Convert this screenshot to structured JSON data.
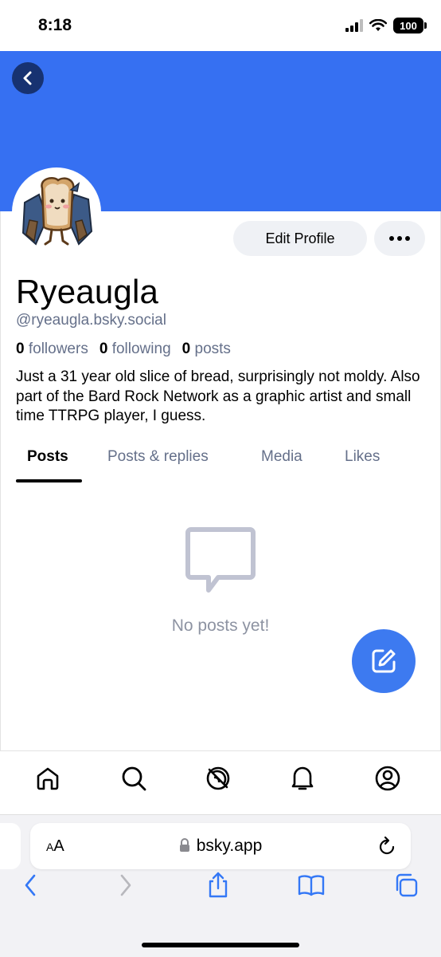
{
  "status_bar": {
    "time": "8:18",
    "battery": "100"
  },
  "profile": {
    "display_name": "Ryeaugla",
    "handle": "@ryeaugla.bsky.social",
    "followers_count": "0",
    "followers_label": "followers",
    "following_count": "0",
    "following_label": "following",
    "posts_count": "0",
    "posts_label": "posts",
    "bio": "Just a 31 year old slice of bread, surprisingly not moldy. Also part of the Bard Rock Network as a graphic artist and small time TTRPG player, I guess.",
    "edit_label": "Edit Profile"
  },
  "tabs": [
    {
      "label": "Posts"
    },
    {
      "label": "Posts & replies"
    },
    {
      "label": "Media"
    },
    {
      "label": "Likes"
    }
  ],
  "empty_state": {
    "text": "No posts yet!"
  },
  "bottom_nav": [
    "home-icon",
    "search-icon",
    "feeds-icon",
    "notifications-icon",
    "profile-icon"
  ],
  "browser": {
    "aa_label_small": "A",
    "aa_label_large": "A",
    "url": "bsky.app"
  },
  "colors": {
    "banner": "#3670f2",
    "fab": "#3d7af0",
    "secondary_text": "#65708a",
    "ios_blue": "#3478f6"
  }
}
